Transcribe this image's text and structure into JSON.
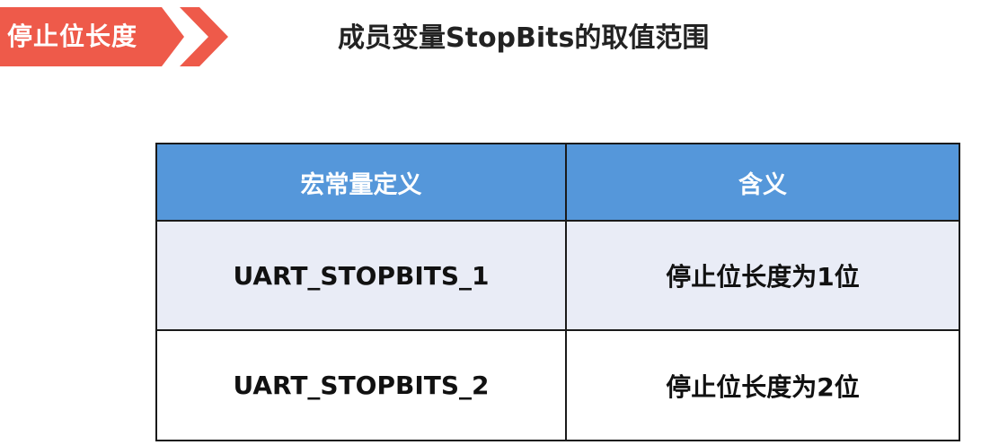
{
  "section_tag": {
    "label": "停止位长度"
  },
  "slide_title": "成员变量StopBits的取值范围",
  "table": {
    "headers": [
      "宏常量定义",
      "含义"
    ],
    "rows": [
      [
        "UART_STOPBITS_1",
        "停止位长度为1位"
      ],
      [
        "UART_STOPBITS_2",
        "停止位长度为2位"
      ]
    ]
  },
  "colors": {
    "tag_red": "#ee5a4a",
    "header_blue": "#5597da",
    "row_shade": "#e9ecf6"
  }
}
